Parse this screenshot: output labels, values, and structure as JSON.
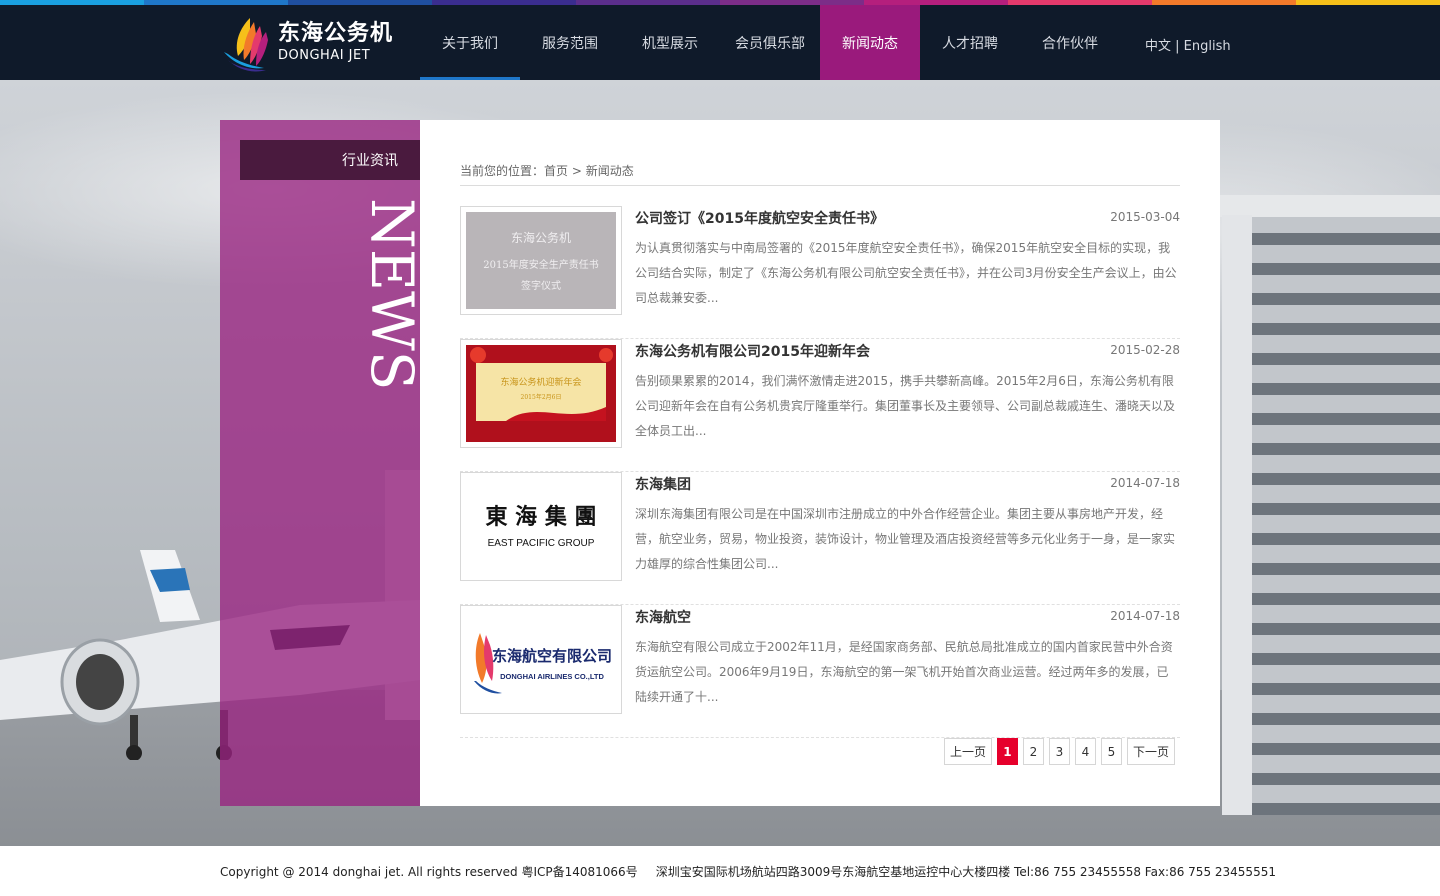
{
  "colors": {
    "strip": [
      "#1aa0e0",
      "#1f77c9",
      "#1f4fa0",
      "#3a2d8f",
      "#5b2e8c",
      "#7c2d88",
      "#b51f7d",
      "#e43a6c",
      "#f27a2a",
      "#f6c01a"
    ],
    "nav_active": "#9a1a7c",
    "header_bg": "#0f1a2a",
    "sidebar": "#992280",
    "pager_current": "#e6002c"
  },
  "logo": {
    "zh": "东海公务机",
    "en": "DONGHAI JET"
  },
  "nav": [
    {
      "label": "关于我们",
      "active": false
    },
    {
      "label": "服务范围",
      "active": false
    },
    {
      "label": "机型展示",
      "active": false
    },
    {
      "label": "会员俱乐部",
      "active": false
    },
    {
      "label": "新闻动态",
      "active": true
    },
    {
      "label": "人才招聘",
      "active": false
    },
    {
      "label": "合作伙伴",
      "active": false
    }
  ],
  "lang": {
    "zh": "中文",
    "sep": " | ",
    "en": "English"
  },
  "sidebar": {
    "category": "行业资讯",
    "watermark": "NEWS"
  },
  "breadcrumb": {
    "prefix": "当前您的位置：",
    "home": "首页",
    "sep": " > ",
    "current": "新闻动态"
  },
  "news": [
    {
      "title": "公司签订《2015年度航空安全责任书》",
      "date": "2015-03-04",
      "desc": "为认真贯彻落实与中南局签署的《2015年度航空安全责任书》，确保2015年航空安全目标的实现，我公司结合实际，制定了《东海公务机有限公司航空安全责任书》，并在公司3月份安全生产会议上，由公司总裁兼安委...",
      "thumb_text": [
        "东海公务机",
        "2015年度安全生产责任书",
        "签字仪式"
      ]
    },
    {
      "title": "东海公务机有限公司2015年迎新年会",
      "date": "2015-02-28",
      "desc": "告别硕果累累的2014，我们满怀激情走进2015，携手共攀新高峰。2015年2月6日，东海公务机有限公司迎新年会在自有公务机贵宾厅隆重举行。集团董事长及主要领导、公司副总裁戚连生、潘晓天以及全体员工出...",
      "thumb_text": [
        "东海公务机迎新年会",
        "2015年2月6日"
      ]
    },
    {
      "title": "东海集团",
      "date": "2014-07-18",
      "desc": "深圳东海集团有限公司是在中国深圳市注册成立的中外合作经营企业。集团主要从事房地产开发，经营，航空业务，贸易，物业投资，装饰设计，物业管理及酒店投资经营等多元化业务于一身，是一家实力雄厚的综合性集团公司...",
      "thumb_text": [
        "東 海 集 團",
        "EAST PACIFIC GROUP"
      ]
    },
    {
      "title": "东海航空",
      "date": "2014-07-18",
      "desc": "东海航空有限公司成立于2002年11月，是经国家商务部、民航总局批准成立的国内首家民营中外合资货运航空公司。2006年9月19日，东海航空的第一架飞机开始首次商业运营。经过两年多的发展，已陆续开通了十...",
      "thumb_text": [
        "东海航空有限公司",
        "DONGHAI AIRLINES CO.,LTD"
      ]
    }
  ],
  "pager": {
    "prev": "上一页",
    "pages": [
      "1",
      "2",
      "3",
      "4",
      "5"
    ],
    "current": "1",
    "next": "下一页"
  },
  "footer": {
    "copyright": "Copyright @ 2014 donghai jet. All rights reserved 粤ICP备14081066号",
    "address": "深圳宝安国际机场航站四路3009号东海航空基地运控中心大楼四楼 Tel:86 755 23455558 Fax:86 755 23455551"
  }
}
